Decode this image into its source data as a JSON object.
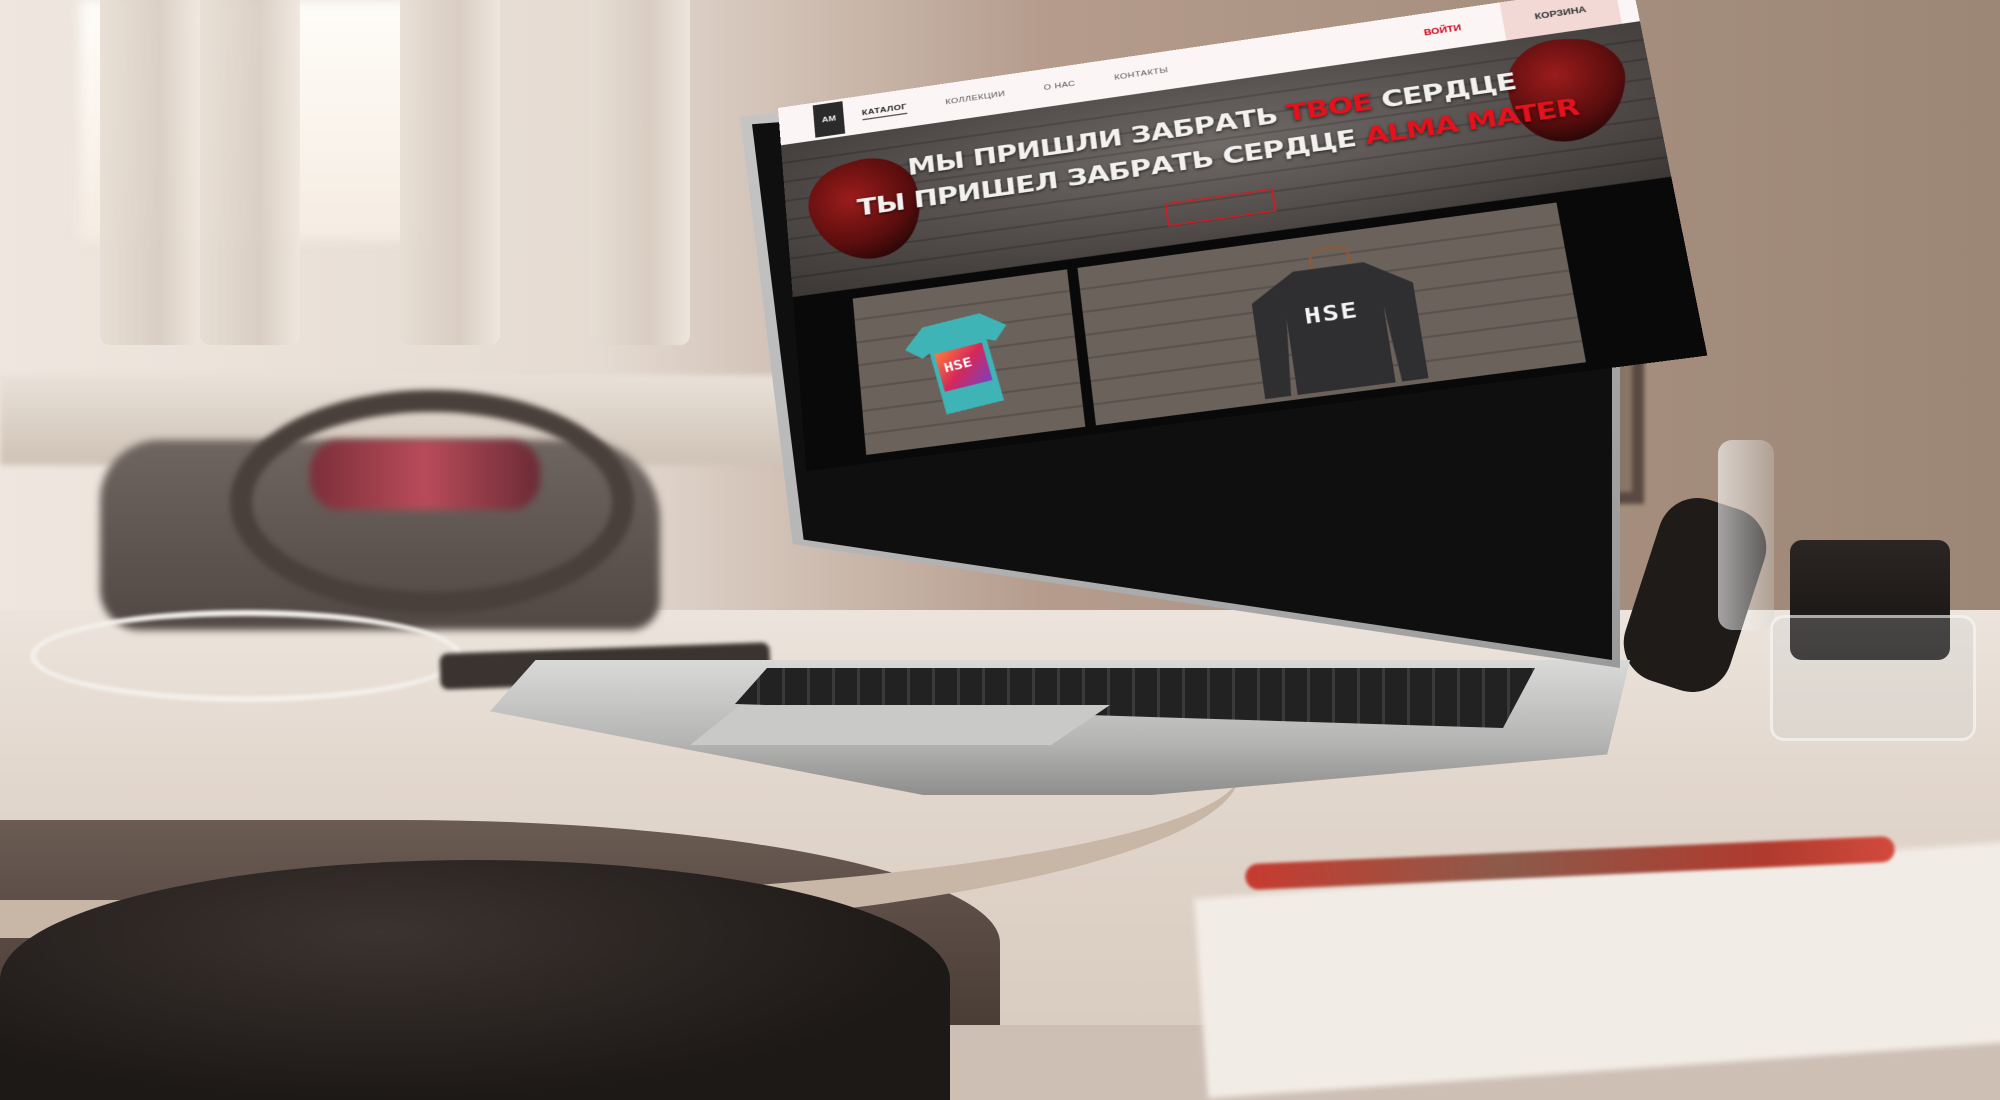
{
  "site": {
    "nav": [
      "Каталог",
      "Коллекции",
      "О нас",
      "Контакты"
    ],
    "login": "ВОЙТИ",
    "cart": "КОРЗИНА"
  },
  "hero": {
    "line1_a": "МЫ ПРИШЛИ ЗАБРАТЬ ",
    "line1_accent": "ТВОЕ",
    "line1_b": " СЕРДЦЕ",
    "line2_a": "ТЫ ПРИШЕЛ ЗАБРАТЬ СЕРДЦЕ ",
    "line2_accent": "ALMA MATER"
  },
  "products": {
    "tshirt_print": "HSE",
    "sweatshirt_print": "HSE"
  },
  "colors": {
    "accent": "#e3121c",
    "header_bg": "#fbf6f5",
    "cart_bg": "#f2d9d6"
  }
}
